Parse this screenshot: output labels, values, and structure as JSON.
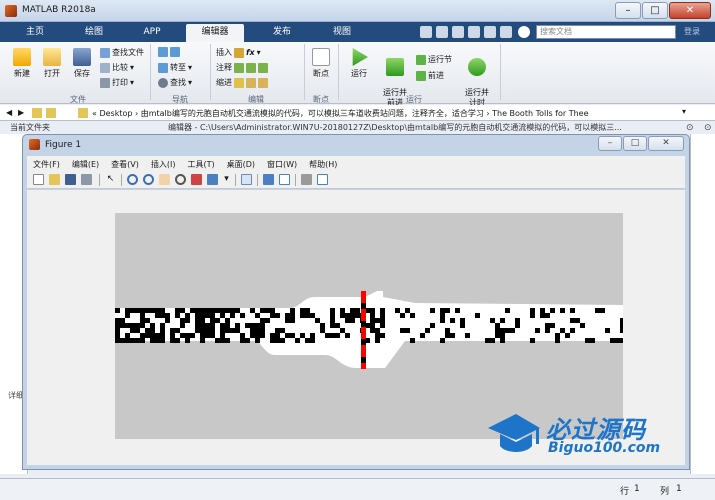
{
  "window": {
    "title": "MATLAB R2018a"
  },
  "tabs": [
    "主页",
    "绘图",
    "APP",
    "编辑器",
    "发布",
    "视图"
  ],
  "search": {
    "placeholder": "搜索文档"
  },
  "login_label": "登录",
  "ribbon": {
    "file": {
      "new": "新建",
      "open": "打开",
      "save": "保存",
      "find_files": "查找文件",
      "compare": "比较",
      "print": "打印",
      "group": "文件"
    },
    "navigate": {
      "goto": "转至",
      "find": "查找",
      "group": "导航"
    },
    "edit": {
      "insert": "插入",
      "comment": "注释",
      "indent": "缩进",
      "fx": "fx",
      "group": "编辑"
    },
    "breakpoints": {
      "label": "断点",
      "group": "断点"
    },
    "run": {
      "run": "运行",
      "run_advance": "运行并\n前进",
      "run_section": "运行节",
      "advance": "前进",
      "run_time": "运行并\n计时",
      "group": "运行"
    }
  },
  "path": {
    "text": "« Desktop › 由mtalb编写的元胞自动机交通流模拟的代码，可以模拟三车道收费站问题，注释齐全，适合学习 › The Booth Tolls for Thee"
  },
  "current_folder_label": "当前文件夹",
  "editor_header": "编辑器 - C:\\Users\\Administrator.WIN7U-20180127Z\\Desktop\\由mtalb编写的元胞自动机交通流模拟的代码，可以模拟三...",
  "details_label": "详细",
  "figure": {
    "title": "Figure 1",
    "menu": [
      "文件(F)",
      "编辑(E)",
      "查看(V)",
      "插入(I)",
      "工具(T)",
      "桌面(D)",
      "窗口(W)",
      "帮助(H)"
    ]
  },
  "status": {
    "row_label": "行",
    "row_value": "1",
    "col_label": "列",
    "col_value": "1"
  },
  "watermark": {
    "cn": "必过源码",
    "en": "Biguo100.com"
  },
  "colors": {
    "tab_bar": "#244b7d",
    "road": "#ffffff",
    "car": "#000000",
    "booth": "#ff0000",
    "background": "#c8c8c8",
    "watermark": "#1e74c9"
  }
}
